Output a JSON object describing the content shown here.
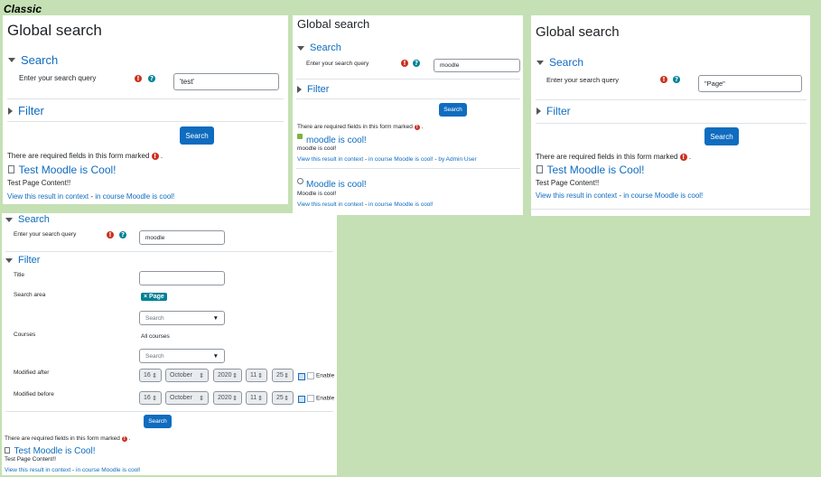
{
  "classic_label": "Classic",
  "panel1": {
    "title": "Global search",
    "search_section": "Search",
    "query_label": "Enter your search query",
    "query_value": "'test'",
    "filter_section": "Filter",
    "search_button": "Search",
    "required_note": "There are required fields in this form marked",
    "result": {
      "title": "Test Moodle is Cool!",
      "content": "Test Page Content!!",
      "context_link": "View this result in context",
      "separator": " - ",
      "course_link": "in course Moodle is cool!"
    }
  },
  "panel2": {
    "title": "Global search",
    "search_section": "Search",
    "query_label": "Enter your search query",
    "query_value": "moodle",
    "filter_section": "Filter",
    "search_button": "Search",
    "required_note": "There are required fields in this form marked",
    "results": [
      {
        "title": "moodle is cool!",
        "content": "moodle is cool!",
        "context_link": "View this result in context",
        "separator": " - ",
        "course_link": "in course Moodle is cool!",
        "author_sep": " - ",
        "author": "by Admin User"
      },
      {
        "title": "Moodle is cool!",
        "content": "Moodle is cool!",
        "context_link": "View this result in context",
        "separator": " - ",
        "course_link": "in course Moodle is cool!"
      }
    ]
  },
  "panel3": {
    "title": "Global search",
    "search_section": "Search",
    "query_label": "Enter your search query",
    "query_value": "\"Page\"",
    "filter_section": "Filter",
    "search_button": "Search",
    "required_note": "There are required fields in this form marked",
    "result": {
      "title": "Test Moodle is Cool!",
      "content": "Test Page Content!!",
      "context_link": "View this result in context",
      "separator": " - ",
      "course_link": "in course Moodle is cool!"
    }
  },
  "panel4": {
    "search_section": "Search",
    "query_label": "Enter your search query",
    "query_value": "moodle",
    "filter_section": "Filter",
    "title_label": "Title",
    "title_value": "",
    "search_area_label": "Search area",
    "search_area_tag": "× Page",
    "search_area_placeholder": "Search",
    "courses_label": "Courses",
    "courses_value": "All courses",
    "courses_placeholder": "Search",
    "modified_after_label": "Modified after",
    "modified_after": {
      "day": "16",
      "month": "October",
      "year": "2020",
      "hour": "11",
      "minute": "25",
      "enable": "Enable"
    },
    "modified_before_label": "Modified before",
    "modified_before": {
      "day": "16",
      "month": "October",
      "year": "2020",
      "hour": "11",
      "minute": "25",
      "enable": "Enable"
    },
    "search_button": "Search",
    "required_note": "There are required fields in this form marked",
    "result": {
      "title": "Test Moodle is Cool!",
      "content": "Test Page Content!!",
      "context_link": "View this result in context",
      "separator": " - ",
      "course_link": "in course Moodle is cool!"
    }
  },
  "colors": {
    "background": "#c5e0b4",
    "link": "#0f6cbf",
    "button": "#0f6cbf",
    "required": "#ca3120",
    "help": "#008196"
  }
}
